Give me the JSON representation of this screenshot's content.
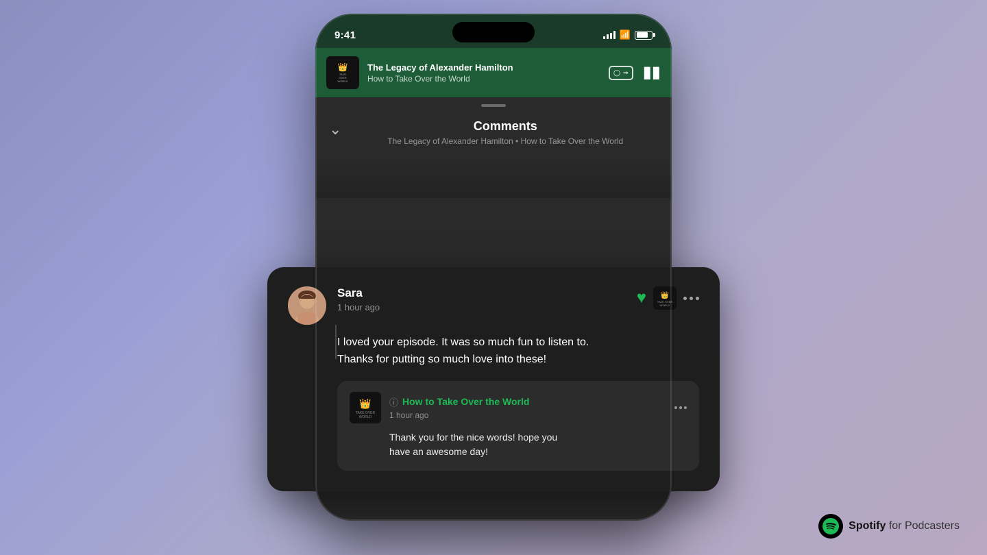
{
  "background": {
    "gradient": "purple-blue"
  },
  "phone": {
    "status_bar": {
      "time": "9:41",
      "signal": "4 bars",
      "wifi": true,
      "battery": "80%"
    },
    "now_playing": {
      "podcast_title": "The Legacy of Alexander Hamilton",
      "podcast_show": "How to Take Over the World",
      "is_playing": true
    },
    "comments_screen": {
      "title": "Comments",
      "subtitle_podcast": "The Legacy of Alexander Hamilton",
      "subtitle_divider": "•",
      "subtitle_show": "How to Take Over the World"
    }
  },
  "comment_card": {
    "user": {
      "name": "Sara",
      "time_ago": "1 hour ago"
    },
    "text_line1": "I loved your episode. It was so much fun to listen to.",
    "text_line2": "Thanks for putting so much love into these!",
    "reply": {
      "podcast_name": "How to Take Over the World",
      "time_ago": "1 hour ago",
      "text_line1": "Thank you for the nice words! hope you",
      "text_line2": "have an awesome day!"
    }
  },
  "branding": {
    "logo_text": "Spotify",
    "suffix": " for Podcasters"
  }
}
